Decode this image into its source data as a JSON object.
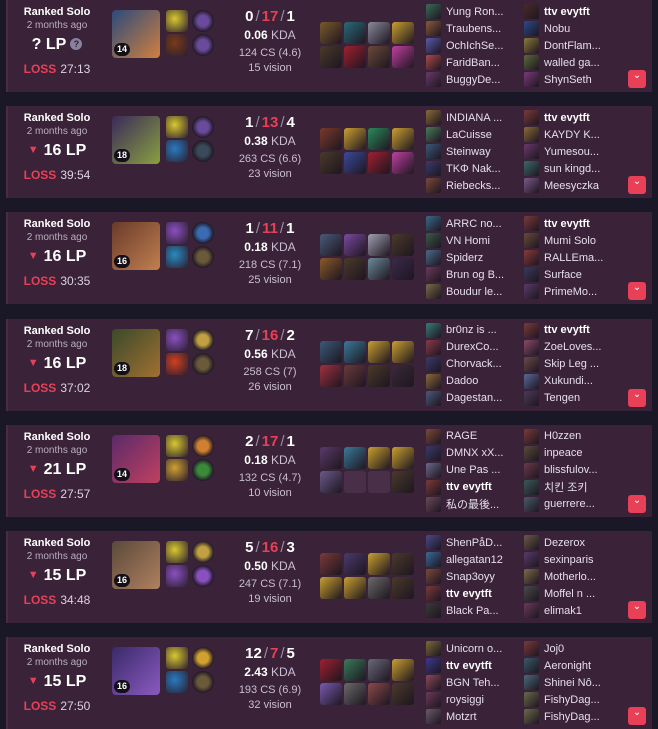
{
  "matches": [
    {
      "queue": "Ranked Solo",
      "ago": "2 months ago",
      "lp": "? LP",
      "lp_trend": "unknown",
      "result": "LOSS",
      "duration": "27:13",
      "level": "14",
      "kills": "0",
      "deaths": "17",
      "assists": "1",
      "kda": "0.06",
      "kda_unit": "KDA",
      "cs": "124 CS (4.6)",
      "vision": "15 vision",
      "champ_colors": [
        "#2c4a7a",
        "#d08040"
      ],
      "spells": [
        "#d9c830",
        "#7a3a1a"
      ],
      "runes": [
        "#6a4a9a",
        "#6a4a9a"
      ],
      "items": [
        "#7a5a2a",
        "#2a6a7a",
        "#8a8a9a",
        "#c9a030",
        "#4a3a2a",
        "#a02030",
        "#6a4a3a",
        "#c040a0"
      ],
      "team1": [
        "Yung Ron...",
        "Traubens...",
        "OchIchSe...",
        "FaridBan...",
        "BuggyDe..."
      ],
      "team2": [
        "ttv evytft",
        "Nobu",
        "DontFlam...",
        "walled ga...",
        "ShynSeth"
      ],
      "me_team": 2,
      "me_index": 0,
      "team1_colors": [
        "#3a6a5a",
        "#8a5a3a",
        "#5a5aaa",
        "#aa4a4a",
        "#6a3a6a"
      ],
      "team2_colors": [
        "#4a2a2a",
        "#2a4a8a",
        "#8a7a3a",
        "#5a6a3a",
        "#7a3a7a"
      ]
    },
    {
      "queue": "Ranked Solo",
      "ago": "2 months ago",
      "lp": "16 LP",
      "lp_trend": "down",
      "result": "LOSS",
      "duration": "39:54",
      "level": "18",
      "kills": "1",
      "deaths": "13",
      "assists": "4",
      "kda": "0.38",
      "kda_unit": "KDA",
      "cs": "263 CS (6.6)",
      "vision": "23 vision",
      "champ_colors": [
        "#3a2a5a",
        "#8aa040"
      ],
      "spells": [
        "#d9c830",
        "#2a7ac0"
      ],
      "runes": [
        "#6a4a9a",
        "#3a4a5a"
      ],
      "items": [
        "#7a3a2a",
        "#c9a030",
        "#2a8a5a",
        "#c9a030",
        "#4a3a2a",
        "#3a4a9a",
        "#a02030",
        "#c040a0"
      ],
      "team1": [
        "INDIANA ...",
        "LaCuisse",
        "Steinway",
        "TKΦ Nak...",
        "Riebecks..."
      ],
      "team2": [
        "ttv evytft",
        "KAYDY K...",
        "Yumesou...",
        "sun kingd...",
        "Meesyczka"
      ],
      "me_team": 2,
      "me_index": 0,
      "team1_colors": [
        "#8a6a3a",
        "#4a7a5a",
        "#3a5a7a",
        "#3a3a6a",
        "#7a4a3a"
      ],
      "team2_colors": [
        "#7a3a3a",
        "#8a6a3a",
        "#6a3a6a",
        "#3a6a6a",
        "#7a5a8a"
      ]
    },
    {
      "queue": "Ranked Solo",
      "ago": "2 months ago",
      "lp": "16 LP",
      "lp_trend": "down",
      "result": "LOSS",
      "duration": "30:35",
      "level": "16",
      "kills": "1",
      "deaths": "11",
      "assists": "1",
      "kda": "0.18",
      "kda_unit": "KDA",
      "cs": "218 CS (7.1)",
      "vision": "25 vision",
      "champ_colors": [
        "#6a3a2a",
        "#c08050"
      ],
      "spells": [
        "#8a50c0",
        "#2a8ac0"
      ],
      "runes": [
        "#3a6ab0",
        "#6a5a3a"
      ],
      "items": [
        "#4a5a7a",
        "#7a4aa0",
        "#a0a0b0",
        "#4a3a2a",
        "#8a5a2a",
        "#4a3a2a",
        "#6a8a9a",
        "#3a2a4a"
      ],
      "team1": [
        "ARRC no...",
        "VN Homi",
        "Spiderz",
        "Brun og B...",
        "Boudur le..."
      ],
      "team2": [
        "ttv evytft",
        "Mumi Solo",
        "RALLEma...",
        "Surface",
        "PrimeMo..."
      ],
      "me_team": 2,
      "me_index": 0,
      "team1_colors": [
        "#3a6a8a",
        "#3a5a4a",
        "#4a6a8a",
        "#6a3a5a",
        "#7a6a4a"
      ],
      "team2_colors": [
        "#7a3a3a",
        "#6a4a3a",
        "#8a3a3a",
        "#3a3a5a",
        "#5a3a6a"
      ]
    },
    {
      "queue": "Ranked Solo",
      "ago": "2 months ago",
      "lp": "16 LP",
      "lp_trend": "down",
      "result": "LOSS",
      "duration": "37:02",
      "level": "18",
      "kills": "7",
      "deaths": "16",
      "assists": "2",
      "kda": "0.56",
      "kda_unit": "KDA",
      "cs": "258 CS (7)",
      "vision": "26 vision",
      "champ_colors": [
        "#3a4a2a",
        "#a07030"
      ],
      "spells": [
        "#8a50c0",
        "#d04020"
      ],
      "runes": [
        "#c0a040",
        "#6a5a3a"
      ],
      "items": [
        "#3a5a7a",
        "#3a7a9a",
        "#c9a030",
        "#c9a030",
        "#a03040",
        "#6a3a3a",
        "#4a3a2a",
        "#3a2a3a"
      ],
      "team1": [
        "br0nz is ...",
        "DurexCo...",
        "Chorvack...",
        "Dadoo",
        "Dagestan..."
      ],
      "team2": [
        "ttv evytft",
        "ZoeLoves...",
        "Skip Leg ...",
        "Xukundi...",
        "Tengen"
      ],
      "me_team": 2,
      "me_index": 0,
      "team1_colors": [
        "#3a7a7a",
        "#8a3a4a",
        "#3a3a6a",
        "#8a6a3a",
        "#4a5a7a"
      ],
      "team2_colors": [
        "#7a3a3a",
        "#8a4a6a",
        "#6a4a4a",
        "#5a6a9a",
        "#4a3a5a"
      ]
    },
    {
      "queue": "Ranked Solo",
      "ago": "2 months ago",
      "lp": "21 LP",
      "lp_trend": "down",
      "result": "LOSS",
      "duration": "27:57",
      "level": "14",
      "kills": "2",
      "deaths": "17",
      "assists": "1",
      "kda": "0.18",
      "kda_unit": "KDA",
      "cs": "132 CS (4.7)",
      "vision": "10 vision",
      "champ_colors": [
        "#5a2a6a",
        "#c04060"
      ],
      "spells": [
        "#d9c830",
        "#d0a030"
      ],
      "runes": [
        "#d08030",
        "#3a8a3a"
      ],
      "items": [
        "#5a3a6a",
        "#3a7a9a",
        "#c9a030",
        "#c9a030",
        "#6a5a8a",
        "empty",
        "empty",
        "#4a3a2a"
      ],
      "team1": [
        "RAGE",
        "DMNX xX...",
        "Une Pas ...",
        "ttv evytft",
        "私の最後..."
      ],
      "team2": [
        "H0zzen",
        "inpeace",
        "blissfulov...",
        "치킨 조키",
        "guerrere..."
      ],
      "me_team": 1,
      "me_index": 3,
      "team1_colors": [
        "#7a4a3a",
        "#3a3a6a",
        "#6a6a8a",
        "#7a3a3a",
        "#6a4a5a"
      ],
      "team2_colors": [
        "#7a3a3a",
        "#5a4a3a",
        "#6a3a4a",
        "#3a5a5a",
        "#4a5a6a"
      ]
    },
    {
      "queue": "Ranked Solo",
      "ago": "2 months ago",
      "lp": "15 LP",
      "lp_trend": "down",
      "result": "LOSS",
      "duration": "34:48",
      "level": "16",
      "kills": "5",
      "deaths": "16",
      "assists": "3",
      "kda": "0.50",
      "kda_unit": "KDA",
      "cs": "247 CS (7.1)",
      "vision": "19 vision",
      "champ_colors": [
        "#5a4a3a",
        "#b08060"
      ],
      "spells": [
        "#d9c830",
        "#8a50c0"
      ],
      "runes": [
        "#c0a040",
        "#8a50c0"
      ],
      "items": [
        "#7a3a3a",
        "#4a3a6a",
        "#c9a030",
        "#4a3a2a",
        "#c9a030",
        "#c9a030",
        "#6a6a6a",
        "#4a3a2a"
      ],
      "team1": [
        "ShenPåD...",
        "allegatan12",
        "Snap3oyy",
        "ttv evytft",
        "Black Pa..."
      ],
      "team2": [
        "Dezerox",
        "sexinparis",
        "Motherlo...",
        "Moffel n ...",
        "elimak1"
      ],
      "me_team": 1,
      "me_index": 3,
      "team1_colors": [
        "#4a4a8a",
        "#3a6a9a",
        "#7a4a3a",
        "#7a3a3a",
        "#3a3a3a"
      ],
      "team2_colors": [
        "#6a5a4a",
        "#5a3a6a",
        "#7a6a4a",
        "#4a4a4a",
        "#6a3a5a"
      ]
    },
    {
      "queue": "Ranked Solo",
      "ago": "2 months ago",
      "lp": "15 LP",
      "lp_trend": "down",
      "result": "LOSS",
      "duration": "27:50",
      "level": "16",
      "kills": "12",
      "deaths": "7",
      "assists": "5",
      "kda": "2.43",
      "kda_unit": "KDA",
      "cs": "193 CS (6.9)",
      "vision": "32 vision",
      "champ_colors": [
        "#3a2a6a",
        "#8a5ac0"
      ],
      "spells": [
        "#d9c830",
        "#2a7ac0"
      ],
      "runes": [
        "#d0a030",
        "#6a5a3a"
      ],
      "items": [
        "#a02030",
        "#3a7a5a",
        "#6a6a7a",
        "#c9a030",
        "#7a5ab0",
        "#6a6a6a",
        "#8a4a4a",
        "#4a3a2a"
      ],
      "team1": [
        "Unicorn o...",
        "ttv evytft",
        "BGN Teh...",
        "roysiggi",
        "Motzrt"
      ],
      "team2": [
        "Joj0",
        "Aeronight",
        "Shinei Nô...",
        "FishyDag...",
        "FishyDag..."
      ],
      "me_team": 1,
      "me_index": 1,
      "team1_colors": [
        "#7a6a3a",
        "#3a3a8a",
        "#8a4a5a",
        "#6a3a5a",
        "#6a5a6a"
      ],
      "team2_colors": [
        "#7a3a3a",
        "#3a5a6a",
        "#4a6a7a",
        "#6a6a4a",
        "#6a6a4a"
      ]
    }
  ],
  "icons": {
    "expand": "chevron-down-icon",
    "help": "question-icon",
    "lp_trend": "triangle-down-icon"
  }
}
